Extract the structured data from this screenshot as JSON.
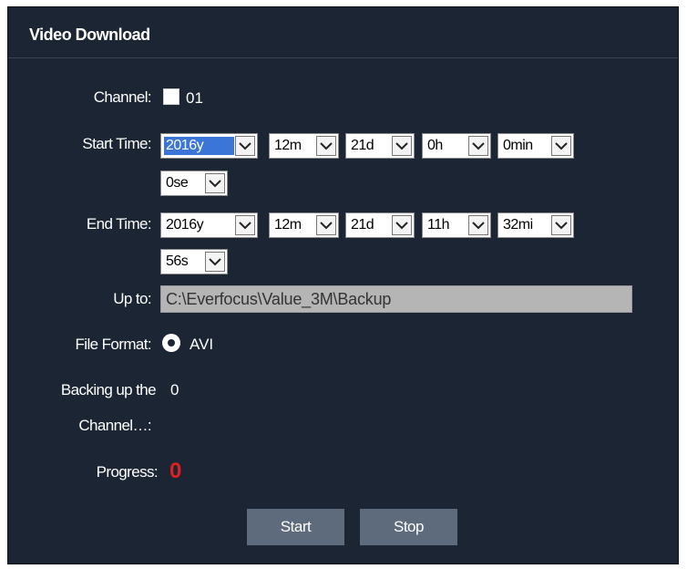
{
  "header": {
    "title": "Video Download"
  },
  "channel": {
    "label": "Channel:",
    "value": "01"
  },
  "start_time": {
    "label": "Start Time:",
    "year": "2016y",
    "month": "12m",
    "day": "21d",
    "hour": "0h",
    "minute": "0min",
    "second": "0se"
  },
  "end_time": {
    "label": "End Time:",
    "year": "2016y",
    "month": "12m",
    "day": "21d",
    "hour": "11h",
    "minute": "32mi",
    "second": "56s"
  },
  "up_to": {
    "label": "Up to:",
    "value": "C:\\Everfocus\\Value_3M\\Backup"
  },
  "file_format": {
    "label": "File Format:",
    "option": "AVI"
  },
  "backing_up": {
    "label_line1": "Backing up the",
    "value": "0",
    "label_line2": "Channel…:"
  },
  "progress": {
    "label": "Progress:",
    "value": "0"
  },
  "buttons": {
    "start": "Start",
    "stop": "Stop"
  },
  "colors": {
    "panel_bg": "#1b2533",
    "button_bg": "#5e6b7c",
    "progress_red": "#e02020",
    "selection_blue": "#3b75d8"
  }
}
